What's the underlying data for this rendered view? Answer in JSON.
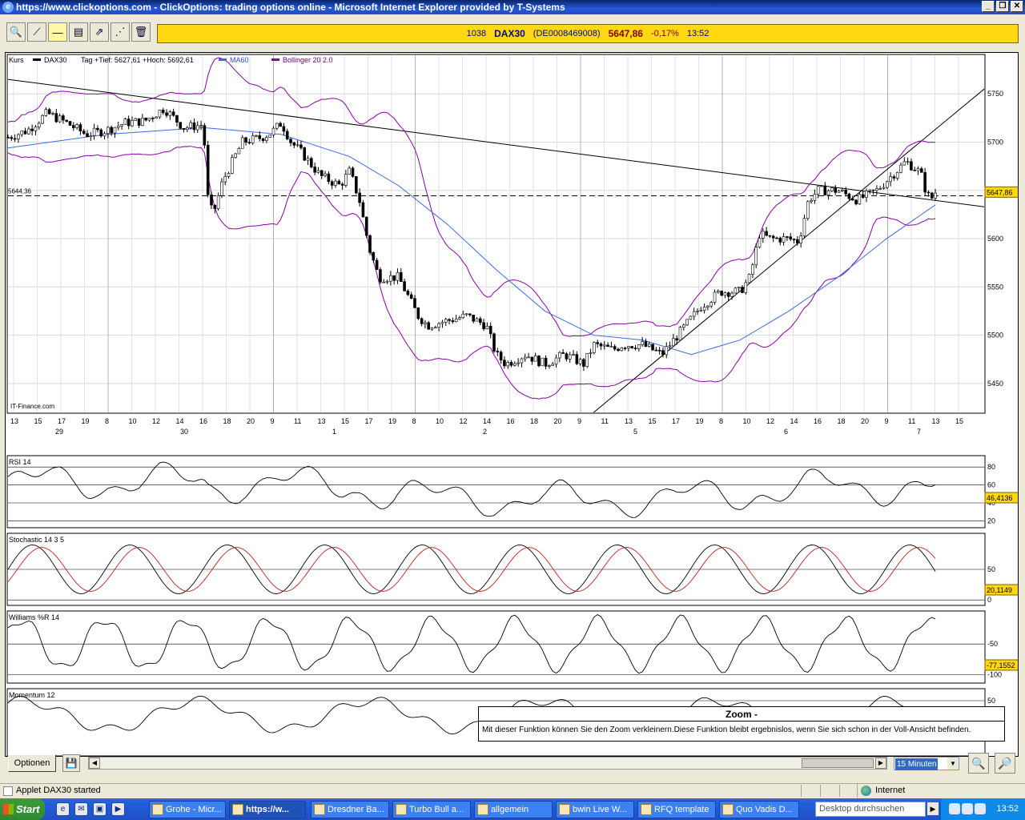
{
  "window": {
    "title": "https://www.clickoptions.com - ClickOptions: trading options online - Microsoft Internet Explorer provided by T-Systems",
    "buttons": [
      "_",
      "❐",
      "✕"
    ]
  },
  "toolbar": {
    "tools": [
      {
        "name": "zoom-magnifier-icon",
        "glyph": "🔍"
      },
      {
        "name": "trendline-icon",
        "glyph": "⟋"
      },
      {
        "name": "horizontal-line-icon",
        "glyph": "—"
      },
      {
        "name": "fibonacci-icon",
        "glyph": "▤"
      },
      {
        "name": "parallel-lines-icon",
        "glyph": "⇗"
      },
      {
        "name": "fan-lines-icon",
        "glyph": "⋰"
      },
      {
        "name": "trash-icon",
        "glyph": "🗑"
      }
    ]
  },
  "quote": {
    "id": "1038",
    "symbol": "DAX30",
    "isin": "(DE0008469008)",
    "price": "5647,86",
    "change": "-0,17%",
    "time": "13:52"
  },
  "legend": {
    "kurs": "Kurs",
    "series": "DAX30",
    "range": "Tag +Tief: 5627,61 +Hoch: 5692,61",
    "ma": "MA60",
    "bb": "Bollinger 20 2.0",
    "source": "IT-Finance.com",
    "hline_label": "5644,36",
    "last_price": "5647,86"
  },
  "panels": {
    "rsi": {
      "label": "RSI 14",
      "value": "46,4136"
    },
    "stoch": {
      "label": "Stochastic 14 3 5",
      "value": "20,1149"
    },
    "williams": {
      "label": "Williams %R 14",
      "value": "-77,1552"
    },
    "momentum": {
      "label": "Momentum 12"
    }
  },
  "chart_data": {
    "type": "candlestick",
    "title": "DAX30",
    "ylim": [
      5420,
      5790
    ],
    "y_ticks": [
      5450,
      5500,
      5550,
      5600,
      5650,
      5700,
      5750
    ],
    "x_hour_ticks": [
      "13",
      "15",
      "17",
      "19",
      "8",
      "10",
      "12",
      "14",
      "16",
      "18",
      "20",
      "9",
      "11",
      "13",
      "15",
      "17",
      "19",
      "8",
      "10",
      "12",
      "14",
      "16",
      "18",
      "20",
      "9",
      "11",
      "13",
      "15",
      "17",
      "19",
      "8",
      "10",
      "12",
      "14",
      "16",
      "18",
      "20",
      "9",
      "11",
      "13",
      "15"
    ],
    "x_day_labels": [
      "29",
      "30",
      "1",
      "2",
      "5",
      "6",
      "7"
    ],
    "rsi_ticks": [
      80,
      60,
      40,
      20
    ],
    "stoch_ticks": [
      50,
      0
    ],
    "williams_ticks": [
      -50,
      -100
    ],
    "momentum_ticks": [
      50
    ],
    "price_path": [
      [
        0,
        5705
      ],
      [
        0.02,
        5712
      ],
      [
        0.04,
        5730
      ],
      [
        0.06,
        5720
      ],
      [
        0.08,
        5708
      ],
      [
        0.1,
        5712
      ],
      [
        0.12,
        5720
      ],
      [
        0.14,
        5722
      ],
      [
        0.16,
        5735
      ],
      [
        0.18,
        5715
      ],
      [
        0.2,
        5718
      ],
      [
        0.205,
        5640
      ],
      [
        0.21,
        5625
      ],
      [
        0.22,
        5660
      ],
      [
        0.24,
        5700
      ],
      [
        0.26,
        5705
      ],
      [
        0.27,
        5710
      ],
      [
        0.28,
        5720
      ],
      [
        0.29,
        5700
      ],
      [
        0.3,
        5690
      ],
      [
        0.32,
        5665
      ],
      [
        0.34,
        5655
      ],
      [
        0.35,
        5670
      ],
      [
        0.36,
        5640
      ],
      [
        0.37,
        5590
      ],
      [
        0.38,
        5560
      ],
      [
        0.4,
        5560
      ],
      [
        0.42,
        5520
      ],
      [
        0.43,
        5510
      ],
      [
        0.45,
        5515
      ],
      [
        0.47,
        5520
      ],
      [
        0.49,
        5510
      ],
      [
        0.5,
        5480
      ],
      [
        0.51,
        5470
      ],
      [
        0.53,
        5480
      ],
      [
        0.55,
        5470
      ],
      [
        0.57,
        5480
      ],
      [
        0.59,
        5470
      ],
      [
        0.6,
        5490
      ],
      [
        0.62,
        5485
      ],
      [
        0.63,
        5490
      ],
      [
        0.65,
        5490
      ],
      [
        0.66,
        5485
      ],
      [
        0.67,
        5480
      ],
      [
        0.69,
        5505
      ],
      [
        0.71,
        5530
      ],
      [
        0.73,
        5545
      ],
      [
        0.75,
        5545
      ],
      [
        0.76,
        5560
      ],
      [
        0.77,
        5605
      ],
      [
        0.78,
        5600
      ],
      [
        0.8,
        5600
      ],
      [
        0.81,
        5597
      ],
      [
        0.82,
        5640
      ],
      [
        0.83,
        5650
      ],
      [
        0.85,
        5650
      ],
      [
        0.87,
        5640
      ],
      [
        0.89,
        5650
      ],
      [
        0.9,
        5660
      ],
      [
        0.91,
        5670
      ],
      [
        0.92,
        5680
      ],
      [
        0.935,
        5668
      ],
      [
        0.94,
        5650
      ],
      [
        0.945,
        5640
      ],
      [
        0.95,
        5648
      ]
    ],
    "ma60_path": [
      [
        0,
        5694
      ],
      [
        0.1,
        5708
      ],
      [
        0.2,
        5715
      ],
      [
        0.28,
        5708
      ],
      [
        0.35,
        5685
      ],
      [
        0.4,
        5655
      ],
      [
        0.45,
        5615
      ],
      [
        0.5,
        5568
      ],
      [
        0.55,
        5525
      ],
      [
        0.6,
        5500
      ],
      [
        0.65,
        5495
      ],
      [
        0.7,
        5480
      ],
      [
        0.75,
        5495
      ],
      [
        0.8,
        5525
      ],
      [
        0.85,
        5560
      ],
      [
        0.9,
        5600
      ],
      [
        0.95,
        5635
      ]
    ]
  },
  "bottom": {
    "options_label": "Optionen",
    "interval": "15 Minuten"
  },
  "tooltip": {
    "title": "Zoom -",
    "text": "Mit dieser Funktion können Sie den Zoom verkleinern.Diese Funktion bleibt ergebnislos, wenn Sie sich schon in der Voll-Ansicht befinden."
  },
  "status": {
    "text": "Applet DAX30 started",
    "zone": "Internet"
  },
  "taskbar": {
    "start": "Start",
    "tasks": [
      "Grohe - Micr...",
      "https://w...",
      "Dresdner Ba...",
      "Turbo Bull a...",
      "allgemein",
      "bwin Live W...",
      "RFQ template",
      "Quo Vadis D..."
    ],
    "search_placeholder": "Desktop durchsuchen",
    "clock": "13:52"
  }
}
